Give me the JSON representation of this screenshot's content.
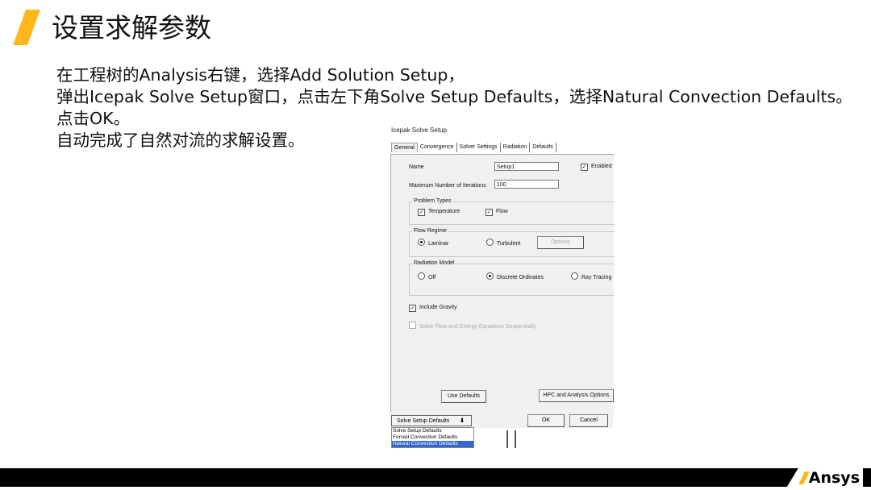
{
  "slide": {
    "title": "设置求解参数",
    "lines": [
      "在工程树的Analysis右键，选择Add Solution Setup，",
      "弹出Icepak Solve Setup窗口，点击左下角Solve Setup Defaults，选择Natural Convection Defaults。",
      "点击OK。",
      "自动完成了自然对流的求解设置。"
    ],
    "logo_text": "Ansys",
    "accent_color": "#ffb71b"
  },
  "dialog": {
    "title": "Icepak Solve Setup",
    "tabs": [
      "General",
      "Convergence",
      "Solver Settings",
      "Radiation",
      "Defaults"
    ],
    "name_label": "Name",
    "name_value": "Setup1",
    "enabled_label": "Enabled",
    "enabled": true,
    "iterations_label": "Maximum Number of Iterations",
    "iterations_value": "100",
    "problem_types_label": "Problem Types",
    "temperature_label": "Temperature",
    "flow_label": "Flow",
    "flow_regime_label": "Flow Regime",
    "laminar_label": "Laminar",
    "turbulent_label": "Turbulent",
    "options_label": "Options",
    "radiation_model_label": "Radiation Model",
    "off_label": "Off",
    "discrete_ordinates_label": "Discrete Ordinates",
    "ray_tracing_label": "Ray Tracing",
    "include_gravity_label": "Include Gravity",
    "solve_sequential_label": "Solve Flow and Energy Equations Sequentially",
    "use_defaults_label": "Use Defaults",
    "hpc_label": "HPC and Analysis Options",
    "ok_label": "OK",
    "cancel_label": "Cancel",
    "defaults_dropdown": {
      "selected": "Solve Setup Defaults",
      "options": [
        "Solve Setup Defaults",
        "Forced Convection Defaults",
        "Natural Convection Defaults"
      ]
    }
  }
}
